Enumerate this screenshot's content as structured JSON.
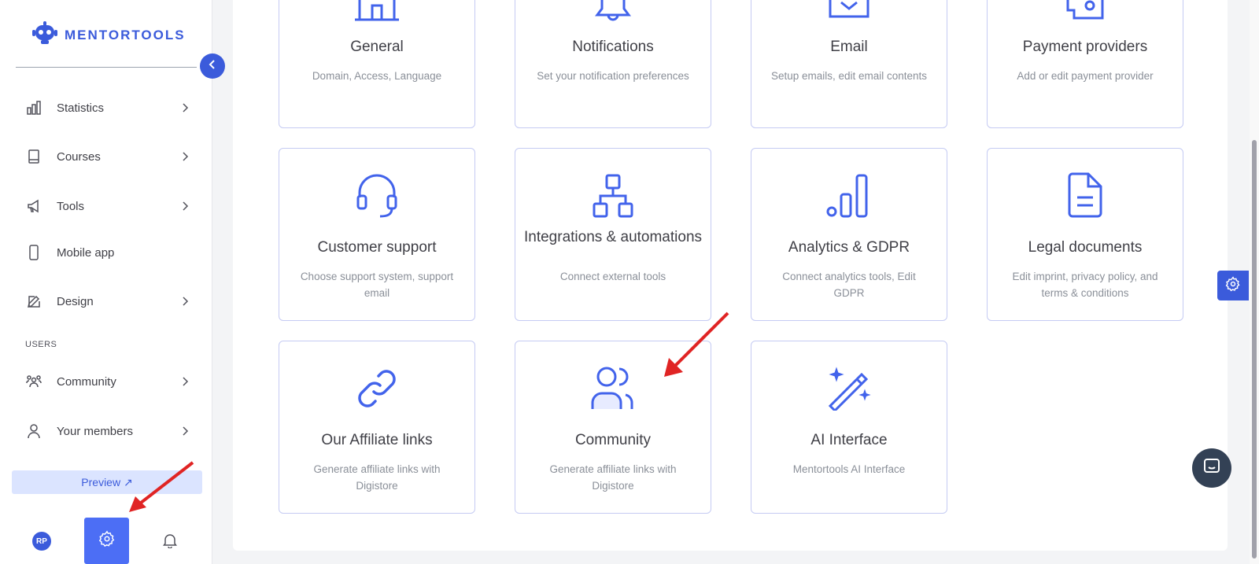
{
  "brand": {
    "name": "MENTORTOOLS"
  },
  "sidebar": {
    "items": [
      {
        "label": "Statistics",
        "icon": "bar-chart-icon",
        "has_chevron": true
      },
      {
        "label": "Courses",
        "icon": "book-icon",
        "has_chevron": true
      },
      {
        "label": "Tools",
        "icon": "megaphone-icon",
        "has_chevron": true
      },
      {
        "label": "Mobile app",
        "icon": "phone-icon",
        "has_chevron": false
      },
      {
        "label": "Design",
        "icon": "pencil-icon",
        "has_chevron": true
      }
    ],
    "users_section_label": "USERS",
    "user_items": [
      {
        "label": "Community",
        "icon": "people-icon",
        "has_chevron": true
      },
      {
        "label": "Your members",
        "icon": "user-icon",
        "has_chevron": true
      }
    ],
    "preview_label": "Preview ↗",
    "avatar_initials": "RP"
  },
  "tiles": [
    {
      "title": "General",
      "description": "Domain, Access, Language",
      "icon": "building-icon"
    },
    {
      "title": "Notifications",
      "description": "Set your notification preferences",
      "icon": "bell-icon"
    },
    {
      "title": "Email",
      "description": "Setup emails, edit email contents",
      "icon": "envelope-icon"
    },
    {
      "title": "Payment providers",
      "description": "Add or edit payment provider",
      "icon": "wallet-icon"
    },
    {
      "title": "Customer support",
      "description": "Choose support system, support email",
      "icon": "headset-icon"
    },
    {
      "title": "Integrations & automations",
      "description": "Connect external tools",
      "icon": "hierarchy-icon"
    },
    {
      "title": "Analytics & GDPR",
      "description": "Connect analytics tools, Edit GDPR",
      "icon": "analytics-icon"
    },
    {
      "title": "Legal documents",
      "description": "Edit imprint, privacy policy, and terms & conditions",
      "icon": "document-icon"
    },
    {
      "title": "Our Affiliate links",
      "description": "Generate affiliate links with Digistore",
      "icon": "link-icon"
    },
    {
      "title": "Community",
      "description": "Generate affiliate links with Digistore",
      "icon": "people-icon"
    },
    {
      "title": "AI Interface",
      "description": "Mentortools AI Interface",
      "icon": "magic-wand-icon"
    }
  ],
  "colors": {
    "accent": "#3b5bdb",
    "icon_blue": "#4263eb",
    "annotation_arrow": "#e02424"
  }
}
